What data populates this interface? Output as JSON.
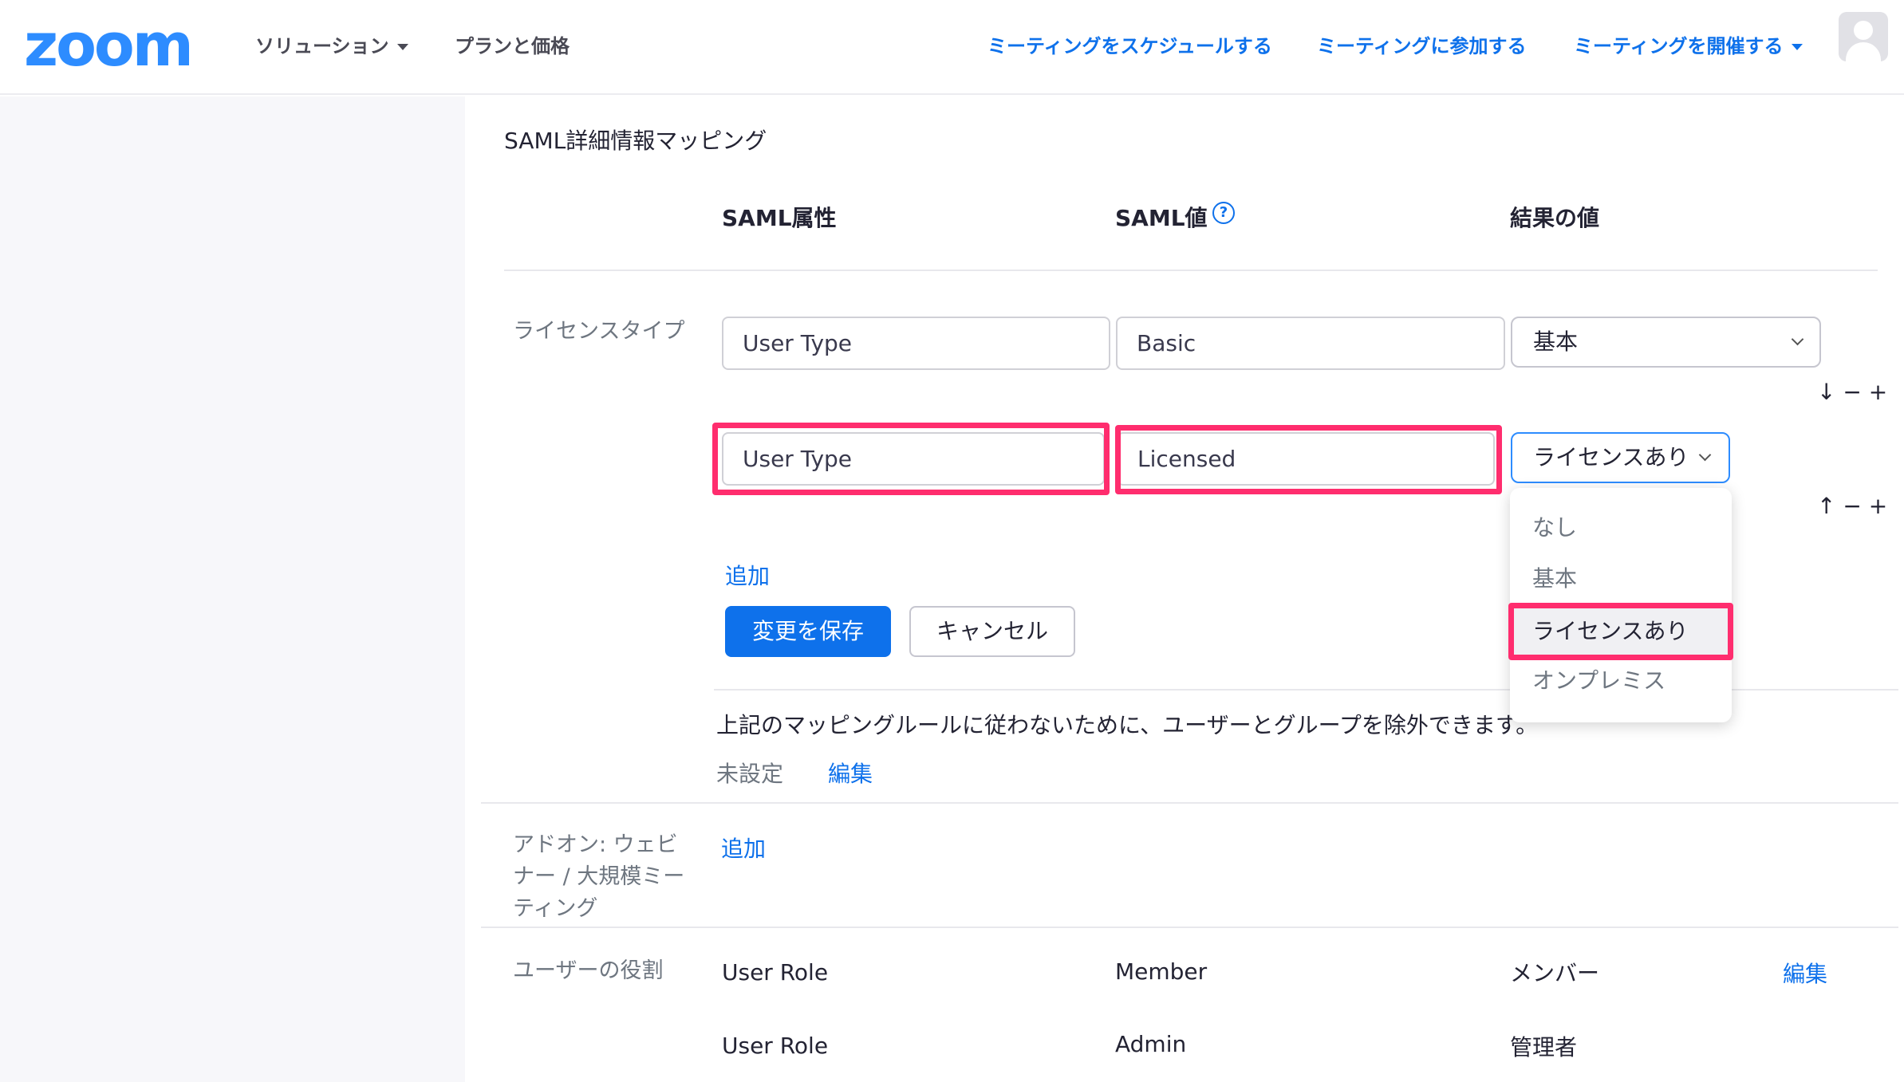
{
  "header": {
    "logo": "zoom",
    "nav_left": [
      "ソリューション",
      "プランと価格"
    ],
    "nav_right": [
      "ミーティングをスケジュールする",
      "ミーティングに参加する",
      "ミーティングを開催する"
    ]
  },
  "section": {
    "title": "SAML詳細情報マッピング",
    "columns": [
      "SAML属性",
      "SAML値",
      "結果の値"
    ],
    "help_icon": "?"
  },
  "license": {
    "label": "ライセンスタイプ",
    "rows": [
      {
        "attribute": "User Type",
        "value": "Basic",
        "result": "基本",
        "controls": "↓ − +"
      },
      {
        "attribute": "User Type",
        "value": "Licensed",
        "result": "ライセンスあり",
        "controls": "↑ − +"
      }
    ],
    "dropdown_options": [
      "なし",
      "基本",
      "ライセンスあり",
      "オンプレミス"
    ],
    "add_link": "追加",
    "save_button": "変更を保存",
    "cancel_button": "キャンセル",
    "exclusion_text": "上記のマッピングルールに従わないために、ユーザーとグループを除外できます。",
    "unset": "未設定",
    "edit": "編集"
  },
  "addon": {
    "label_lines": [
      "アドオン: ウェビ",
      "ナー / 大規模ミー",
      "ティング"
    ],
    "add_link": "追加"
  },
  "roles": {
    "label": "ユーザーの役割",
    "rows": [
      {
        "attribute": "User Role",
        "value": "Member",
        "result": "メンバー",
        "edit": "編集"
      },
      {
        "attribute": "User Role",
        "value": "Admin",
        "result": "管理者"
      }
    ]
  }
}
